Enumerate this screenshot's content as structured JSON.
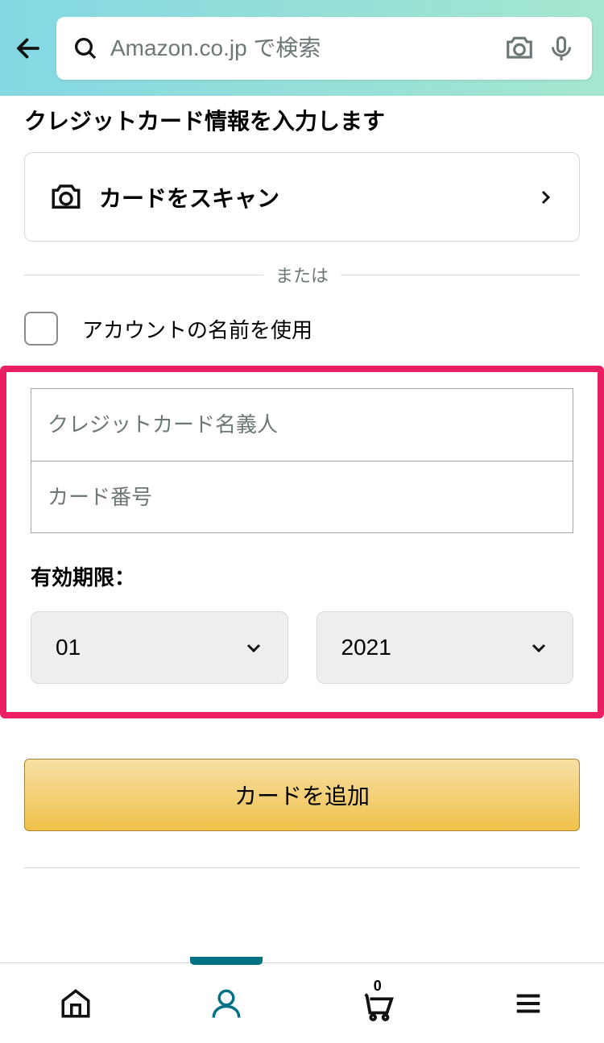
{
  "header": {
    "search_placeholder": "Amazon.co.jp で検索"
  },
  "page": {
    "title": "クレジットカード情報を入力します",
    "scan_card_label": "カードをスキャン",
    "divider_text": "または",
    "use_account_name_label": "アカウントの名前を使用",
    "cardholder_placeholder": "クレジットカード名義人",
    "card_number_placeholder": "カード番号",
    "expiry_label": "有効期限：",
    "expiry_month": "01",
    "expiry_year": "2021",
    "add_card_label": "カードを追加"
  },
  "nav": {
    "cart_count": "0"
  }
}
